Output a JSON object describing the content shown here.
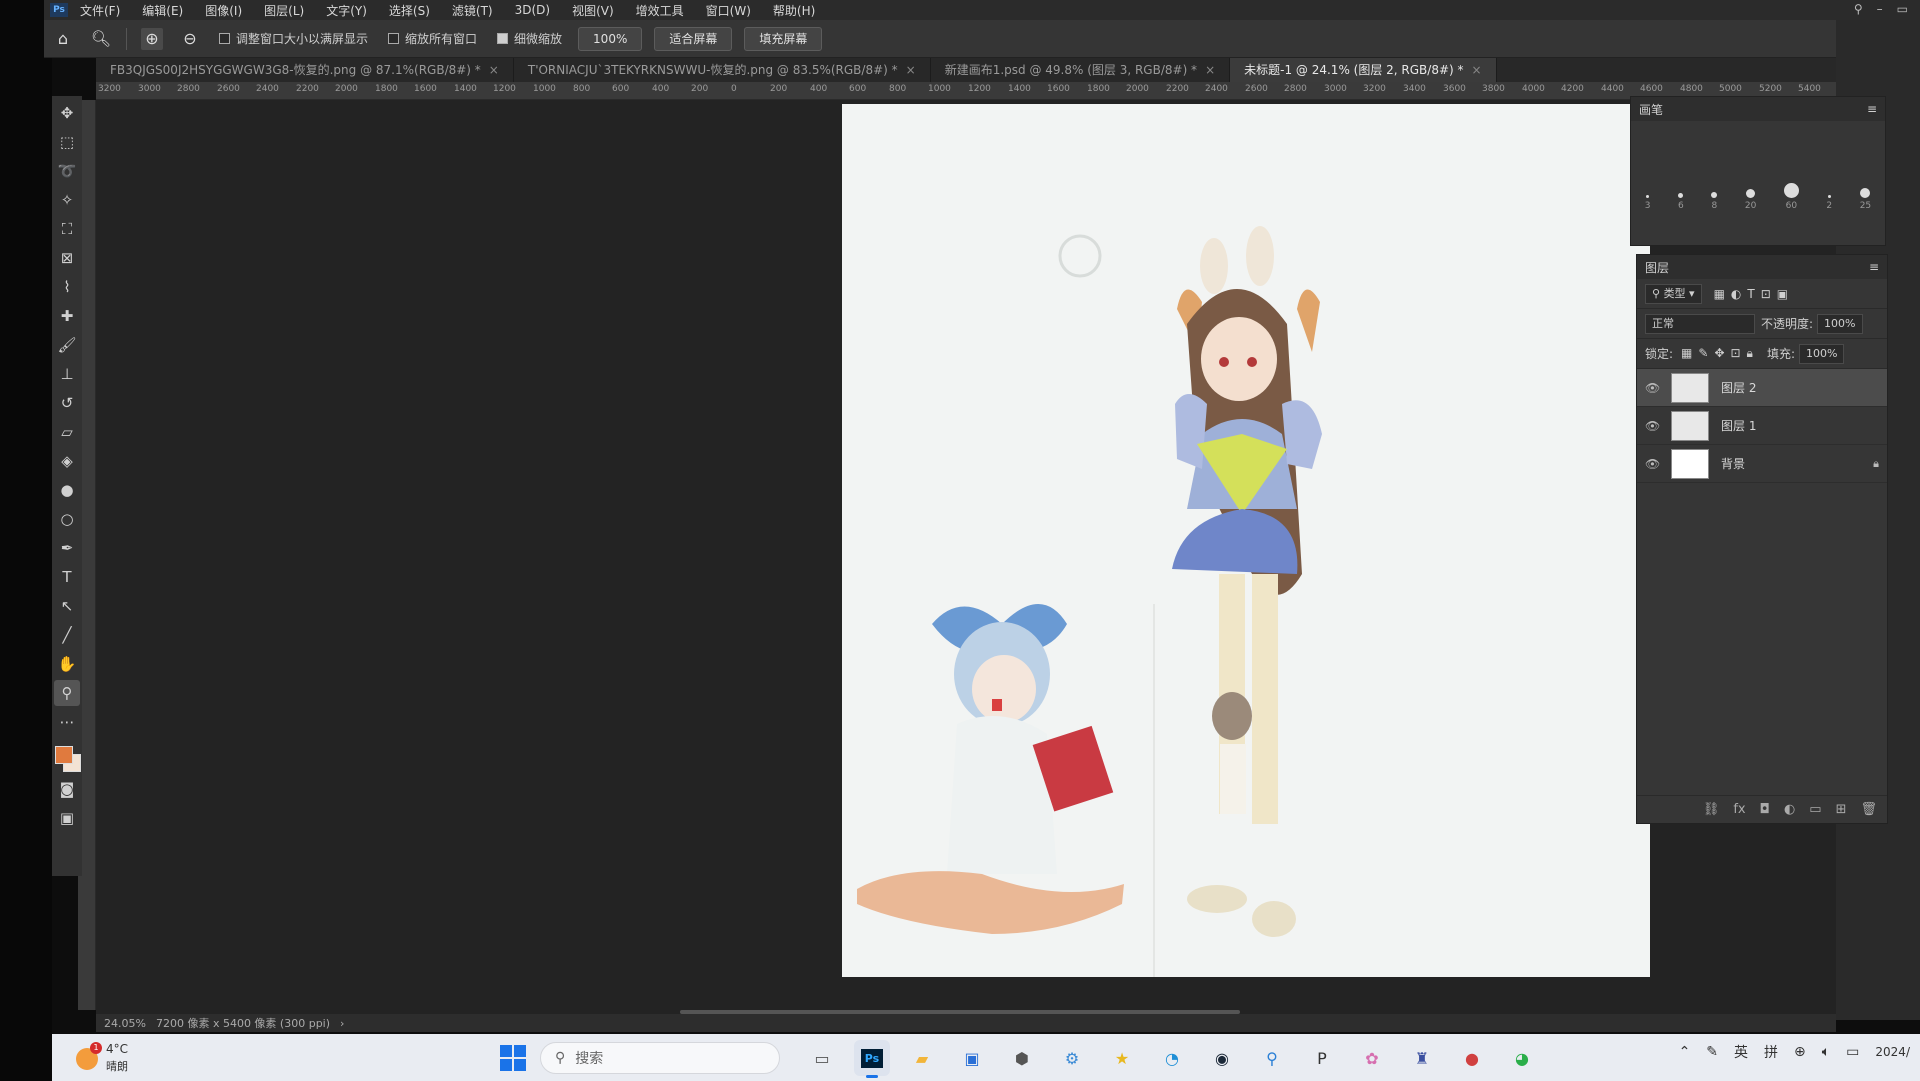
{
  "menubar": {
    "items": [
      "文件(F)",
      "编辑(E)",
      "图像(I)",
      "图层(L)",
      "文字(Y)",
      "选择(S)",
      "滤镜(T)",
      "3D(D)",
      "视图(V)",
      "增效工具",
      "窗口(W)",
      "帮助(H)"
    ]
  },
  "options": {
    "resize_windows_label": "调整窗口大小以满屏显示",
    "zoom_all_label": "缩放所有窗口",
    "scrubby_zoom_label": "细微缩放",
    "zoom_btn": "100%",
    "fit_screen_btn": "适合屏幕",
    "fill_screen_btn": "填充屏幕"
  },
  "tabs": [
    {
      "label": "FB3QJGS00J2HSYGGWGW3G8-恢复的.png @ 87.1%(RGB/8#) *"
    },
    {
      "label": "T'ORNIACJU`3TEKYRKNSWWU-恢复的.png @ 83.5%(RGB/8#) *"
    },
    {
      "label": "新建画布1.psd @ 49.8% (图层 3, RGB/8#) *"
    },
    {
      "label": "未标题-1 @ 24.1% (图层 2, RGB/8#) *"
    }
  ],
  "active_tab_index": 3,
  "ruler_ticks": [
    "3200",
    "3000",
    "2800",
    "2600",
    "2400",
    "2200",
    "2000",
    "1800",
    "1600",
    "1400",
    "1200",
    "1000",
    "800",
    "600",
    "400",
    "200",
    "0",
    "200",
    "400",
    "600",
    "800",
    "1000",
    "1200",
    "1400",
    "1600",
    "1800",
    "2000",
    "2200",
    "2400",
    "2600",
    "2800",
    "3000",
    "3200",
    "3400",
    "3600",
    "3800",
    "4000",
    "4200",
    "4400",
    "4600",
    "4800",
    "5000",
    "5200",
    "5400"
  ],
  "status": {
    "zoom": "24.05%",
    "doc_size": "7200 像素 x 5400 像素 (300 ppi)"
  },
  "brush_panel": {
    "title": "画笔",
    "brush_sizes": [
      "3",
      "6",
      "8",
      "20",
      "60",
      "2",
      "25"
    ]
  },
  "layers_panel": {
    "title": "图层",
    "filter_label": "类型",
    "blend_mode": "正常",
    "opacity_label": "不透明度:",
    "opacity_value": "100%",
    "lock_label": "锁定:",
    "fill_label": "填充:",
    "fill_value": "100%",
    "layers": [
      {
        "name": "图层 2",
        "selected": true,
        "locked": false
      },
      {
        "name": "图层 1",
        "selected": false,
        "locked": false
      },
      {
        "name": "背景",
        "selected": false,
        "locked": true
      }
    ]
  },
  "taskbar": {
    "weather_temp": "4°C",
    "weather_cond": "晴朗",
    "weather_badge": "1",
    "search_placeholder": "搜索",
    "tray_lang": "英",
    "tray_ime": "拼",
    "clock": "2024/"
  },
  "colors": {
    "foreground": "#e07a3e",
    "background": "#f3e3d4",
    "accent": "#1a73e8"
  }
}
